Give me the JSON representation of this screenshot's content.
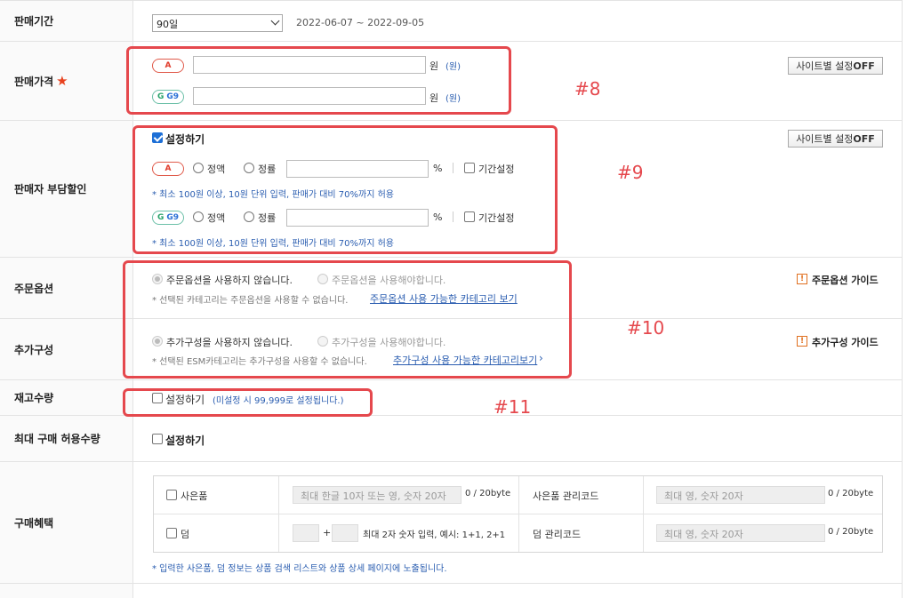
{
  "rows": {
    "sale_period": {
      "label": "판매기간",
      "select_value": "90일",
      "date_range": "2022-06-07 ~ 2022-09-05"
    },
    "sale_price": {
      "label": "판매가격",
      "star": "★",
      "site_a": {
        "badge": "A",
        "unit": "원",
        "unit_note": "(원)"
      },
      "site_g": {
        "badge_g": "G",
        "badge_g9": "G9",
        "unit": "원",
        "unit_note": "(원)"
      },
      "site_setting_button": "사이트별 설정",
      "site_setting_state": "OFF"
    },
    "seller_discount": {
      "label": "판매자 부담할인",
      "enable_label": "설정하기",
      "site_setting_button": "사이트별 설정",
      "site_setting_state": "OFF",
      "site_a": {
        "badge": "A",
        "fixed": "정액",
        "rate": "정률",
        "percent": "%",
        "period": "기간설정",
        "note": "* 최소 100원 이상, 10원 단위 입력, 판매가 대비 70%까지 허용"
      },
      "site_g": {
        "badge_g": "G",
        "badge_g9": "G9",
        "fixed": "정액",
        "rate": "정률",
        "percent": "%",
        "period": "기간설정",
        "note": "* 최소 100원 이상, 10원 단위 입력, 판매가 대비 70%까지 허용"
      }
    },
    "order_option": {
      "label": "주문옵션",
      "opt_no": "주문옵션을 사용하지 않습니다.",
      "opt_yes": "주문옵션을 사용해야합니다.",
      "note": "* 선택된 카테고리는 주문옵션을 사용할 수 없습니다.",
      "link": "주문옵션 사용 가능한 카테고리 보기",
      "guide_icon": "!",
      "guide": "주문옵션 가이드"
    },
    "additional": {
      "label": "추가구성",
      "opt_no": "추가구성을 사용하지 않습니다.",
      "opt_yes": "추가구성을 사용해야합니다.",
      "note": "* 선택된 ESM카테고리는 추가구성을 사용할 수 없습니다.",
      "link": "추가구성 사용 가능한 카테고리보기",
      "link_arrow": "›",
      "guide_icon": "!",
      "guide": "추가구성 가이드"
    },
    "stock": {
      "label": "재고수량",
      "enable_label": "설정하기",
      "note": "(미설정 시 99,999로 설정됩니다.)"
    },
    "max_purchase": {
      "label": "최대 구매 허용수량",
      "enable_label": "설정하기"
    },
    "benefit": {
      "label": "구매혜택",
      "gift": {
        "label": "사은품",
        "placeholder": "최대 한글 10자 또는 영, 숫자 20자",
        "count": "0 / 20byte",
        "code_label": "사은품 관리코드",
        "code_placeholder": "최대 영, 숫자 20자",
        "code_count": "0 / 20byte"
      },
      "bonus": {
        "label": "덤",
        "plus": "+",
        "hint": "최대 2자 숫자 입력, 예시: 1+1, 2+1",
        "code_label": "덤 관리코드",
        "code_placeholder": "최대 영, 숫자 20자",
        "code_count": "0 / 20byte"
      },
      "note": "* 입력한 사은품, 덤 정보는 상품 검색 리스트와 상품 상세 페이지에 노출됩니다."
    }
  },
  "annotations": [
    "#8",
    "#9",
    "#10",
    "#11"
  ],
  "colors": {
    "annotation": "#e5484d",
    "accent_blue": "#2a5db0",
    "checkbox_checked": "#1d6fd6"
  }
}
